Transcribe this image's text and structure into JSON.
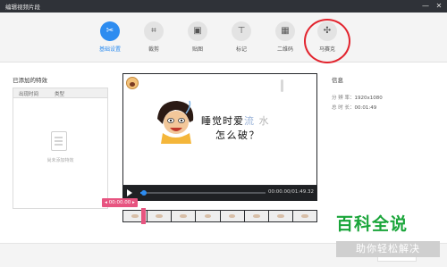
{
  "window": {
    "title": "编辑视频片段",
    "minimize": "—",
    "close": "✕"
  },
  "toolbar": {
    "tools": [
      {
        "label": "基础设置",
        "icon": "scissors-icon",
        "glyph": "✂"
      },
      {
        "label": "裁剪",
        "icon": "crop-icon",
        "glyph": "⌗"
      },
      {
        "label": "贴图",
        "icon": "image-icon",
        "glyph": "▣"
      },
      {
        "label": "标记",
        "icon": "pin-icon",
        "glyph": "⊤"
      },
      {
        "label": "二维码",
        "icon": "qrcode-icon",
        "glyph": "▦"
      },
      {
        "label": "马赛克",
        "icon": "mosaic-icon",
        "glyph": "✣"
      }
    ],
    "active_index": 0,
    "accent": "#2d8cf0",
    "highlight_color": "#e2232d"
  },
  "effects": {
    "title": "已添加的特效",
    "columns": [
      "出现时间",
      "类型"
    ],
    "empty_text": "尚未添加特效"
  },
  "preview": {
    "caption_line1": "睡觉时爱",
    "caption_blur1": "流",
    "caption_blur2": "水",
    "caption_line2": "怎么破？",
    "timecode": "00:00.00/01:49.32",
    "progress": 0.03
  },
  "timeline": {
    "marker_time": "00:00.00",
    "marker_color": "#e75480"
  },
  "info": {
    "title": "信息",
    "resolution_label": "分 辨 率：",
    "resolution_value": "1920x1080",
    "duration_label": "总 时 长：",
    "duration_value": "00:01:49"
  },
  "watermark": {
    "title": "百科全说",
    "subtitle": "助你轻松解决",
    "color": "#1aa53a"
  }
}
